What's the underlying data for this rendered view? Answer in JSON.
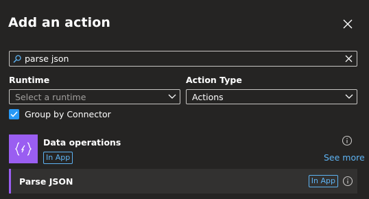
{
  "panel": {
    "title": "Add an action"
  },
  "icons": {
    "close": "close-icon",
    "search": "search-icon",
    "clear": "clear-icon",
    "chevron": "chevron-down-icon",
    "check": "checkmark-icon",
    "info": "info-icon",
    "connector": "data-operations-icon"
  },
  "search": {
    "value": "parse json"
  },
  "filters": {
    "runtime": {
      "label": "Runtime",
      "placeholder": "Select a runtime"
    },
    "action_type": {
      "label": "Action Type",
      "value": "Actions"
    }
  },
  "group_by_connector": {
    "label": "Group by Connector",
    "checked": true
  },
  "connector": {
    "name": "Data operations",
    "badge": "In App",
    "see_more": "See more"
  },
  "actions": [
    {
      "name": "Parse JSON",
      "badge": "In App"
    }
  ],
  "colors": {
    "background": "#252423",
    "accent_purple": "#9a5ef1",
    "link_blue": "#5eb4f4",
    "checkbox_blue": "#2899f5",
    "row_bg": "#323130"
  }
}
